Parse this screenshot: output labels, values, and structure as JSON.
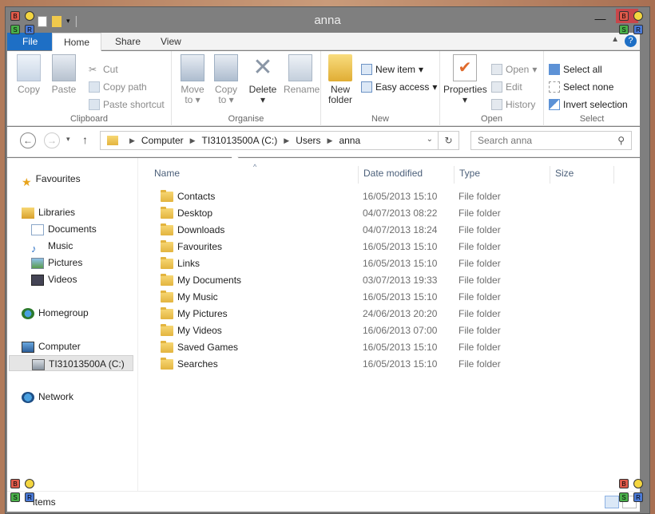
{
  "window": {
    "title": "anna"
  },
  "ribbon_tabs": [
    {
      "label": "File"
    },
    {
      "label": "Home"
    },
    {
      "label": "Share"
    },
    {
      "label": "View"
    }
  ],
  "ribbon": {
    "clipboard": {
      "label": "Clipboard",
      "copy": "Copy",
      "paste": "Paste",
      "cut": "Cut",
      "copy_path": "Copy path",
      "paste_shortcut": "Paste shortcut"
    },
    "organise": {
      "label": "Organise",
      "move_to": [
        "Move",
        "to"
      ],
      "copy_to": [
        "Copy",
        "to"
      ],
      "delete": "Delete",
      "rename": "Rename"
    },
    "new": {
      "label": "New",
      "new_folder": [
        "New",
        "folder"
      ],
      "new_item": "New item",
      "easy_access": "Easy access"
    },
    "open": {
      "label": "Open",
      "properties": "Properties",
      "open": "Open",
      "edit": "Edit",
      "history": "History"
    },
    "select": {
      "label": "Select",
      "select_all": "Select all",
      "select_none": "Select none",
      "invert_selection": "Invert selection"
    }
  },
  "address": {
    "crumbs": [
      "Computer",
      "TI31013500A (C:)",
      "Users",
      "anna"
    ],
    "search_placeholder": "Search anna"
  },
  "nav": {
    "favourites": "Favourites",
    "libraries": "Libraries",
    "documents": "Documents",
    "music": "Music",
    "pictures": "Pictures",
    "videos": "Videos",
    "homegroup": "Homegroup",
    "computer": "Computer",
    "drive": "TI31013500A (C:)",
    "network": "Network"
  },
  "columns": {
    "name": "Name",
    "date": "Date modified",
    "type": "Type",
    "size": "Size"
  },
  "files": [
    {
      "name": "Contacts",
      "date": "16/05/2013 15:10",
      "type": "File folder"
    },
    {
      "name": "Desktop",
      "date": "04/07/2013 08:22",
      "type": "File folder"
    },
    {
      "name": "Downloads",
      "date": "04/07/2013 18:24",
      "type": "File folder"
    },
    {
      "name": "Favourites",
      "date": "16/05/2013 15:10",
      "type": "File folder"
    },
    {
      "name": "Links",
      "date": "16/05/2013 15:10",
      "type": "File folder"
    },
    {
      "name": "My Documents",
      "date": "03/07/2013 19:33",
      "type": "File folder"
    },
    {
      "name": "My Music",
      "date": "16/05/2013 15:10",
      "type": "File folder"
    },
    {
      "name": "My Pictures",
      "date": "24/06/2013 20:20",
      "type": "File folder"
    },
    {
      "name": "My Videos",
      "date": "16/06/2013 07:00",
      "type": "File folder"
    },
    {
      "name": "Saved Games",
      "date": "16/05/2013 15:10",
      "type": "File folder"
    },
    {
      "name": "Searches",
      "date": "16/05/2013 15:10",
      "type": "File folder"
    }
  ],
  "status": {
    "count": "items"
  },
  "sys_tiles": {
    "b": "B",
    "s": "S",
    "r": "R"
  }
}
